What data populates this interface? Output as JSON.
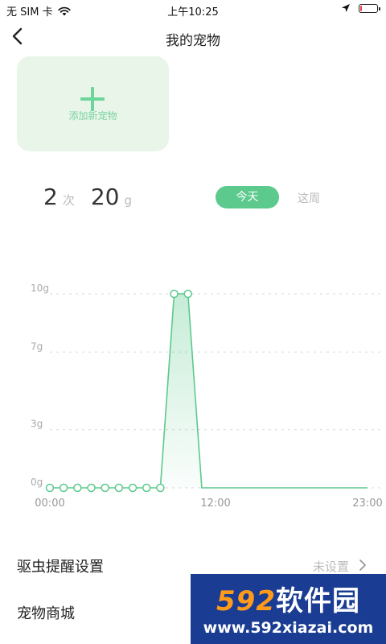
{
  "status_bar": {
    "carrier": "无 SIM 卡",
    "time": "上午10:25",
    "battery_color": "#e8403c",
    "battery_level": 0.12
  },
  "nav": {
    "title": "我的宠物",
    "back_icon": "chevron-left-icon"
  },
  "add_pet": {
    "label": "添加新宠物",
    "icon": "plus-icon",
    "accent": "#6cd59a",
    "background": "#e9f5e9"
  },
  "stats": {
    "count": "2",
    "count_unit": "次",
    "amount": "20",
    "amount_unit": "g"
  },
  "range_toggle": {
    "today": "今天",
    "week": "这周",
    "active": "today",
    "active_color": "#5cc98d"
  },
  "chart_data": {
    "type": "area",
    "yticks": [
      "10g",
      "7g",
      "3g",
      "0g"
    ],
    "ytick_values": [
      10,
      7,
      3,
      0
    ],
    "xticks": [
      "00:00",
      "12:00",
      "23:00"
    ],
    "xtick_values": [
      0,
      12,
      23
    ],
    "ylim": [
      0,
      10
    ],
    "xlim": [
      0,
      23
    ],
    "grid": true,
    "line_color": "#5cc98d",
    "series": [
      {
        "points": [
          {
            "x": 0,
            "y": 0,
            "marker": true
          },
          {
            "x": 1,
            "y": 0,
            "marker": true
          },
          {
            "x": 2,
            "y": 0,
            "marker": true
          },
          {
            "x": 3,
            "y": 0,
            "marker": true
          },
          {
            "x": 4,
            "y": 0,
            "marker": true
          },
          {
            "x": 5,
            "y": 0,
            "marker": true
          },
          {
            "x": 6,
            "y": 0,
            "marker": true
          },
          {
            "x": 7,
            "y": 0,
            "marker": true
          },
          {
            "x": 8,
            "y": 0,
            "marker": true
          },
          {
            "x": 9,
            "y": 10,
            "marker": true
          },
          {
            "x": 10,
            "y": 10,
            "marker": true
          },
          {
            "x": 11,
            "y": 0,
            "marker": false
          },
          {
            "x": 23,
            "y": 0,
            "marker": false
          }
        ]
      }
    ]
  },
  "menu": [
    {
      "label": "驱虫提醒设置",
      "value": "未设置",
      "icon": "chevron-right-icon"
    },
    {
      "label": "宠物商城"
    }
  ],
  "watermark": {
    "top_digits": "592",
    "top_text": "软件园",
    "bottom": "www.592xiazai.com"
  }
}
